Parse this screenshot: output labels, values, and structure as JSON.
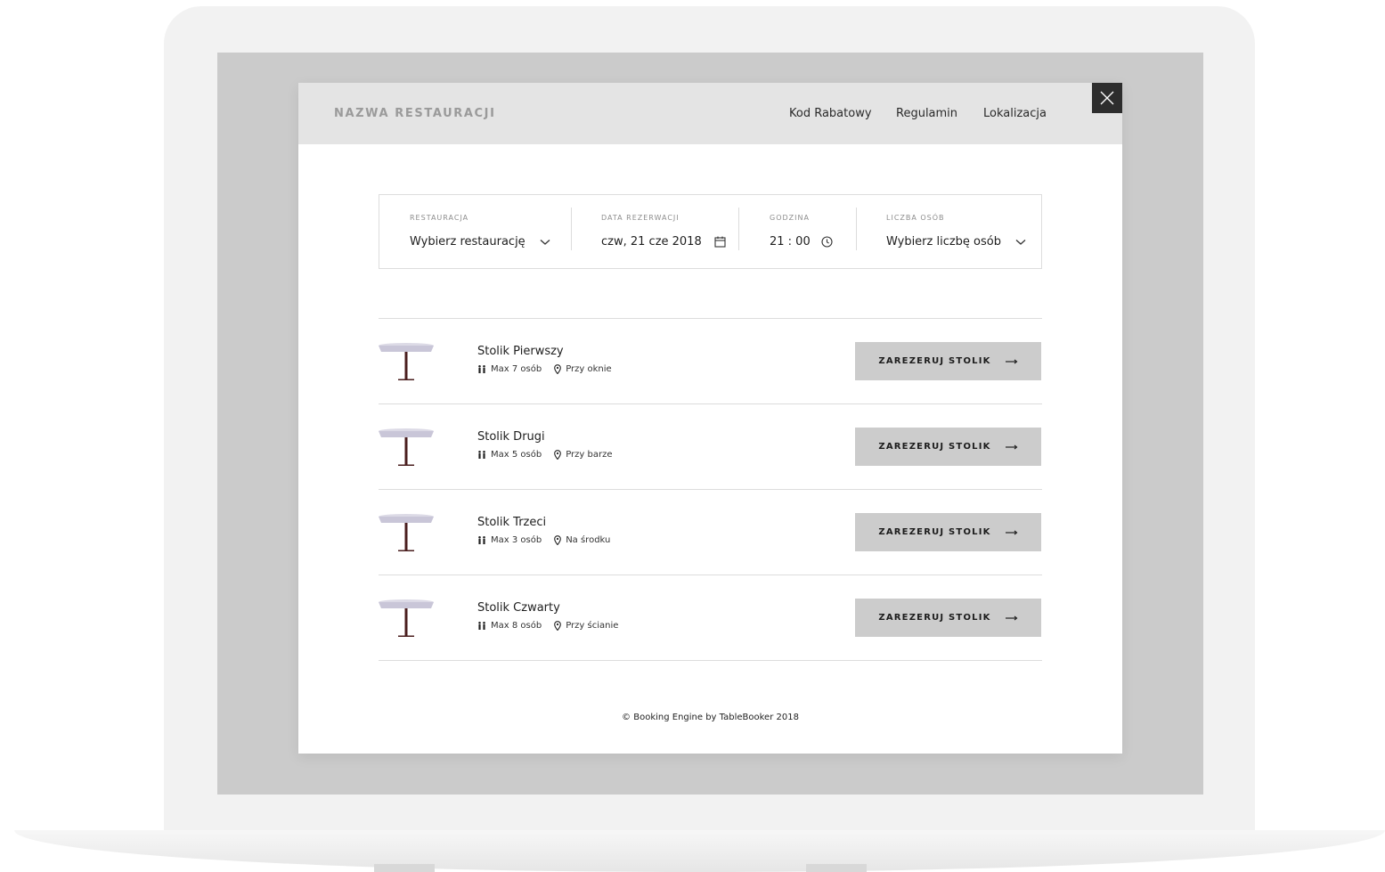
{
  "header": {
    "restaurant_name": "NAZWA RESTAURACJI",
    "nav": [
      "Kod Rabatowy",
      "Regulamin",
      "Lokalizacja"
    ],
    "close_icon": "close-icon"
  },
  "filters": {
    "restaurant": {
      "label": "RESTAURACJA",
      "value": "Wybierz restaurację",
      "icon": "chevron-down-icon"
    },
    "date": {
      "label": "DATA REZERWACJI",
      "value": "czw, 21 cze 2018",
      "icon": "calendar-icon"
    },
    "time": {
      "label": "GODZINA",
      "value": "21 : 00",
      "icon": "clock-icon"
    },
    "guests": {
      "label": "LICZBA OSÓB",
      "value": "Wybierz liczbę osób",
      "icon": "chevron-down-icon"
    }
  },
  "tables": [
    {
      "name": "Stolik Pierwszy",
      "capacity": "Max 7 osób",
      "location": "Przy oknie",
      "button": "ZAREZERUJ STOLIK"
    },
    {
      "name": "Stolik Drugi",
      "capacity": "Max 5 osób",
      "location": "Przy barze",
      "button": "ZAREZERUJ STOLIK"
    },
    {
      "name": "Stolik Trzeci",
      "capacity": "Max 3 osób",
      "location": "Na środku",
      "button": "ZAREZERUJ STOLIK"
    },
    {
      "name": "Stolik Czwarty",
      "capacity": "Max 8 osób",
      "location": "Przy ścianie",
      "button": "ZAREZERUJ STOLIK"
    }
  ],
  "colors": {
    "header_bg": "#e4e4e4",
    "button_bg": "#cccccc",
    "table_top": "#c9c6d8",
    "table_leg": "#4a1e1e"
  },
  "footer": {
    "text": "© Booking Engine by TableBooker 2018"
  }
}
